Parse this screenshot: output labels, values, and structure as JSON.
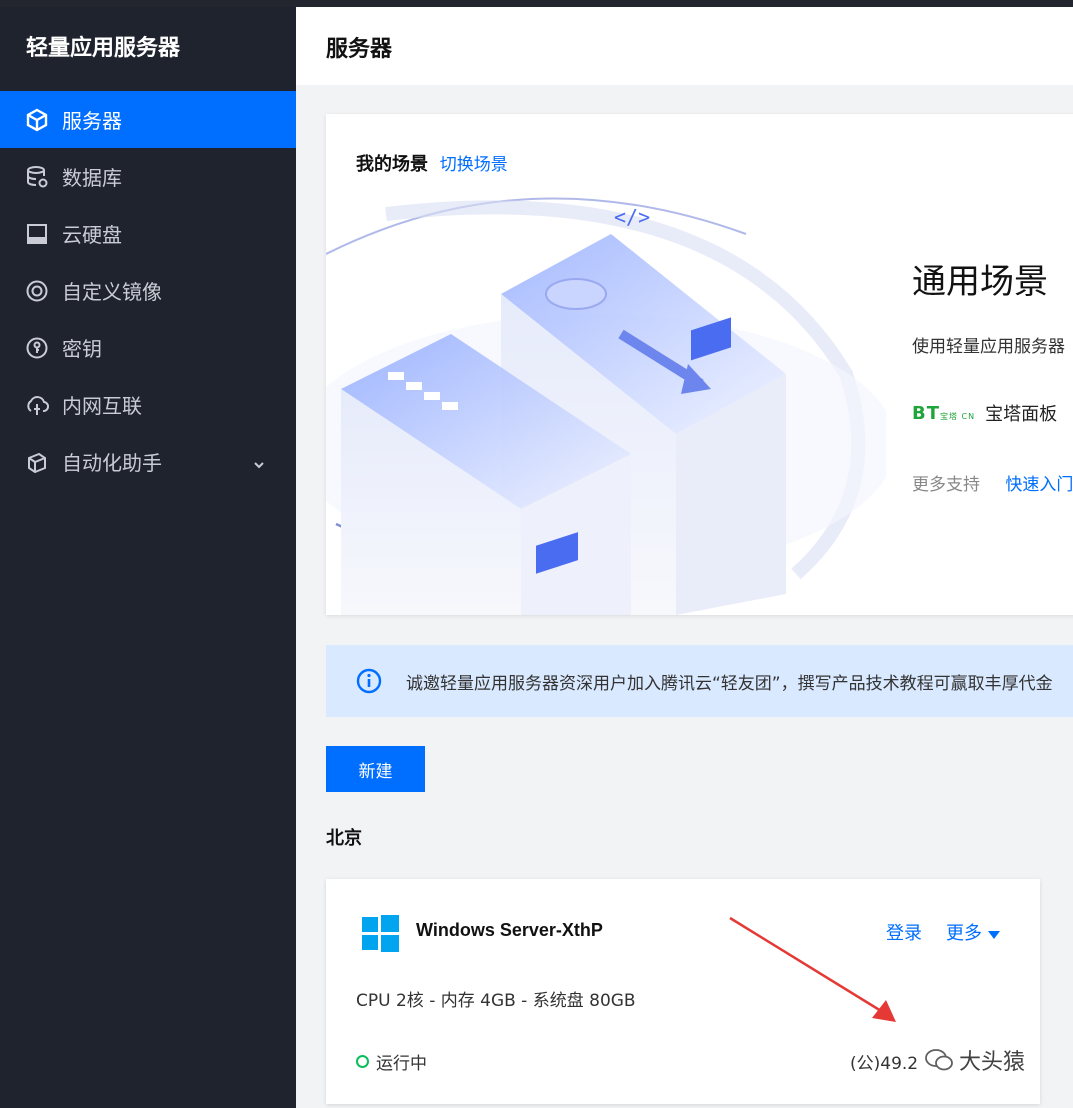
{
  "sidebar": {
    "brand": "轻量应用服务器",
    "items": [
      {
        "label": "服务器",
        "icon": "cube-icon",
        "active": true
      },
      {
        "label": "数据库",
        "icon": "database-icon"
      },
      {
        "label": "云硬盘",
        "icon": "disk-icon"
      },
      {
        "label": "自定义镜像",
        "icon": "image-icon"
      },
      {
        "label": "密钥",
        "icon": "key-icon"
      },
      {
        "label": "内网互联",
        "icon": "network-icon"
      },
      {
        "label": "自动化助手",
        "icon": "automation-icon",
        "has_submenu": true
      }
    ]
  },
  "header": {
    "title": "服务器"
  },
  "scene": {
    "heading": "我的场景",
    "switch_link": "切换场景",
    "title": "通用场景",
    "description": "使用轻量应用服务器",
    "panel_logo": "BT",
    "panel_logo_suffix": "宝塔 CN",
    "panel_label": "宝塔面板",
    "more_support": "更多支持",
    "quick_link": "快速入门"
  },
  "banner": {
    "text": "诚邀轻量应用服务器资深用户加入腾讯云“轻友团”，撰写产品技术教程可赢取丰厚代金"
  },
  "actions": {
    "new_label": "新建"
  },
  "region": {
    "name": "北京"
  },
  "server": {
    "name": "Windows Server-XthP",
    "login": "登录",
    "more": "更多",
    "spec": "CPU 2核 - 内存 4GB - 系统盘 80GB",
    "status": "运行中",
    "ip": "(公)49.2"
  },
  "watermark": {
    "text": "大头猿"
  },
  "colors": {
    "accent": "#006eff",
    "sidebar_bg": "#1f232d",
    "running": "#0abf5b",
    "banner_bg": "#d9e9ff",
    "annotation": "#e53935"
  }
}
